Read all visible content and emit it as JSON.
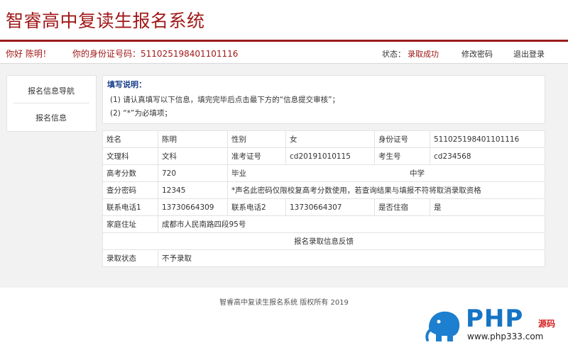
{
  "app": {
    "title": "智睿高中复读生报名系统"
  },
  "user_bar": {
    "greeting": "你好 陈明！",
    "id_label": "你的身份证号码：",
    "id_value": "511025198401101116",
    "status_label": "状态：",
    "status_value": "录取成功",
    "change_password": "修改密码",
    "logout": "退出登录"
  },
  "sidebar": {
    "items": [
      {
        "label": "报名信息导航"
      },
      {
        "label": "报名信息"
      }
    ]
  },
  "notes": {
    "title": "填写说明：",
    "items": [
      "(1)  请认真填写以下信息，填完完毕后点击最下方的“信息提交审核”；",
      "(2)  “*”为必填项；"
    ]
  },
  "form": {
    "name_label": "姓名",
    "name_value": "陈明",
    "gender_label": "性别",
    "gender_value": "女",
    "idcard_label": "身份证号",
    "idcard_value": "511025198401101116",
    "subject_label": "文理科",
    "subject_value": "文科",
    "admit_no_label": "准考证号",
    "admit_no_value": "cd20191010115",
    "exam_no_label": "考生号",
    "exam_no_value": "cd234568",
    "score_label": "高考分数",
    "score_value": "720",
    "school_label": "毕业",
    "school_value": "中学",
    "query_pw_label": "查分密码",
    "query_pw_value": "12345",
    "query_pw_note": "*声名此密码仅限校复高考分数使用，若查询结果与填报不符将取消录取资格",
    "phone1_label": "联系电话1",
    "phone1_value": "13730664309",
    "phone2_label": "联系电话2",
    "phone2_value": "13730664307",
    "boarding_label": "是否住宿",
    "boarding_value": "是",
    "address_label": "家庭住址",
    "address_value": "成都市人民南路四段95号",
    "feedback_title": "报名录取信息反馈",
    "admission_label": "录取状态",
    "admission_value": "不予录取"
  },
  "footer": {
    "text": "智睿高中复读生报名系统  版权所有    2019"
  },
  "watermark": {
    "brand": "PHP",
    "suffix": "源码",
    "url": "www.php333.com"
  }
}
